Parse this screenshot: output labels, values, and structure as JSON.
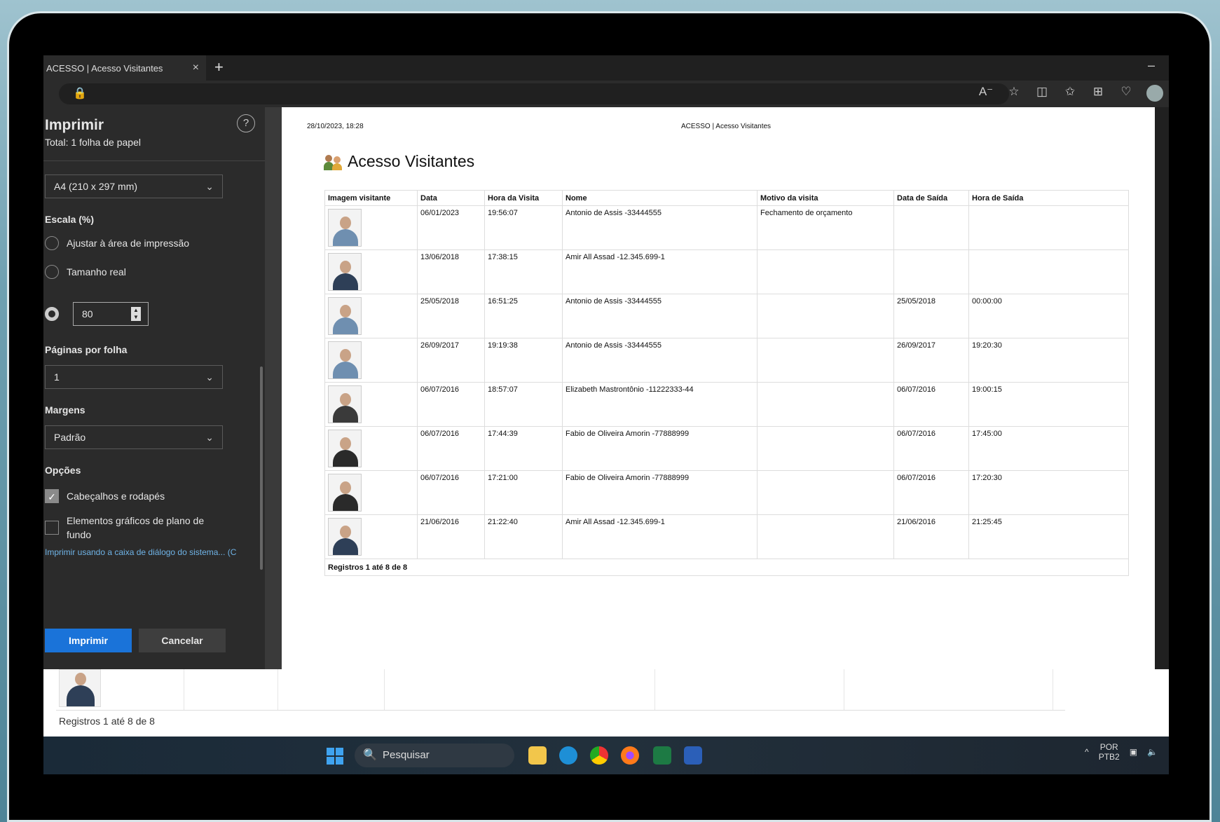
{
  "browser": {
    "tab_title": "ACESSO | Acesso Visitantes",
    "tab_close": "×",
    "new_tab": "+",
    "minimize": "–",
    "lock": "🔒",
    "toolbar_icons": [
      "read-aloud-icon",
      "favorite-star-icon",
      "split-screen-icon",
      "favorites-icon",
      "collections-icon",
      "performance-icon",
      "profile-icon"
    ]
  },
  "print_panel": {
    "title": "Imprimir",
    "subtitle": "Total: 1 folha de papel",
    "help": "?",
    "paper_size": "A4 (210 x 297 mm)",
    "scale_label": "Escala (%)",
    "scale_fit": "Ajustar à área de impressão",
    "scale_actual": "Tamanho real",
    "scale_value": "80",
    "pages_per_sheet_label": "Páginas por folha",
    "pages_per_sheet": "1",
    "margins_label": "Margens",
    "margins": "Padrão",
    "options_label": "Opções",
    "headers_footers": "Cabeçalhos e rodapés",
    "background_graphics": "Elementos gráficos de plano de fundo",
    "system_dialog": "Imprimir usando a caixa de diálogo do sistema... (C",
    "print_button": "Imprimir",
    "cancel_button": "Cancelar"
  },
  "preview": {
    "date": "28/10/2023, 18:28",
    "header": "ACESSO | Acesso Visitantes",
    "title": "Acesso Visitantes",
    "columns": [
      "Imagem visitante",
      "Data",
      "Hora da Visita",
      "Nome",
      "Motivo da visita",
      "Data de Saída",
      "Hora de Saída"
    ],
    "rows": [
      {
        "date": "06/01/2023",
        "time": "19:56:07",
        "name": "Antonio de Assis -33444555",
        "reason": "Fechamento de orçamento",
        "exit_date": "",
        "exit_time": "",
        "avatar": "#6f8fb0"
      },
      {
        "date": "13/06/2018",
        "time": "17:38:15",
        "name": "Amir All Assad -12.345.699-1",
        "reason": "",
        "exit_date": "",
        "exit_time": "",
        "avatar": "#2e3f57"
      },
      {
        "date": "25/05/2018",
        "time": "16:51:25",
        "name": "Antonio de Assis -33444555",
        "reason": "",
        "exit_date": "25/05/2018",
        "exit_time": "00:00:00",
        "avatar": "#6f8fb0"
      },
      {
        "date": "26/09/2017",
        "time": "19:19:38",
        "name": "Antonio de Assis -33444555",
        "reason": "",
        "exit_date": "26/09/2017",
        "exit_time": "19:20:30",
        "avatar": "#6f8fb0"
      },
      {
        "date": "06/07/2016",
        "time": "18:57:07",
        "name": "Elizabeth Mastrontônio -11222333-44",
        "reason": "",
        "exit_date": "06/07/2016",
        "exit_time": "19:00:15",
        "avatar": "#3a3a3a"
      },
      {
        "date": "06/07/2016",
        "time": "17:44:39",
        "name": "Fabio de Oliveira Amorin -77888999",
        "reason": "",
        "exit_date": "06/07/2016",
        "exit_time": "17:45:00",
        "avatar": "#2a2a2a"
      },
      {
        "date": "06/07/2016",
        "time": "17:21:00",
        "name": "Fabio de Oliveira Amorin -77888999",
        "reason": "",
        "exit_date": "06/07/2016",
        "exit_time": "17:20:30",
        "avatar": "#2a2a2a"
      },
      {
        "date": "21/06/2016",
        "time": "21:22:40",
        "name": "Amir All Assad -12.345.699-1",
        "reason": "",
        "exit_date": "21/06/2016",
        "exit_time": "21:25:45",
        "avatar": "#2e3f57"
      }
    ],
    "footer": "Registros 1 até 8 de 8"
  },
  "behind_page": {
    "footer": "Registros 1 até 8 de 8"
  },
  "taskbar": {
    "search_placeholder": "Pesquisar",
    "lang_top": "POR",
    "lang_bottom": "PTB2",
    "tray_arrow": "^"
  }
}
